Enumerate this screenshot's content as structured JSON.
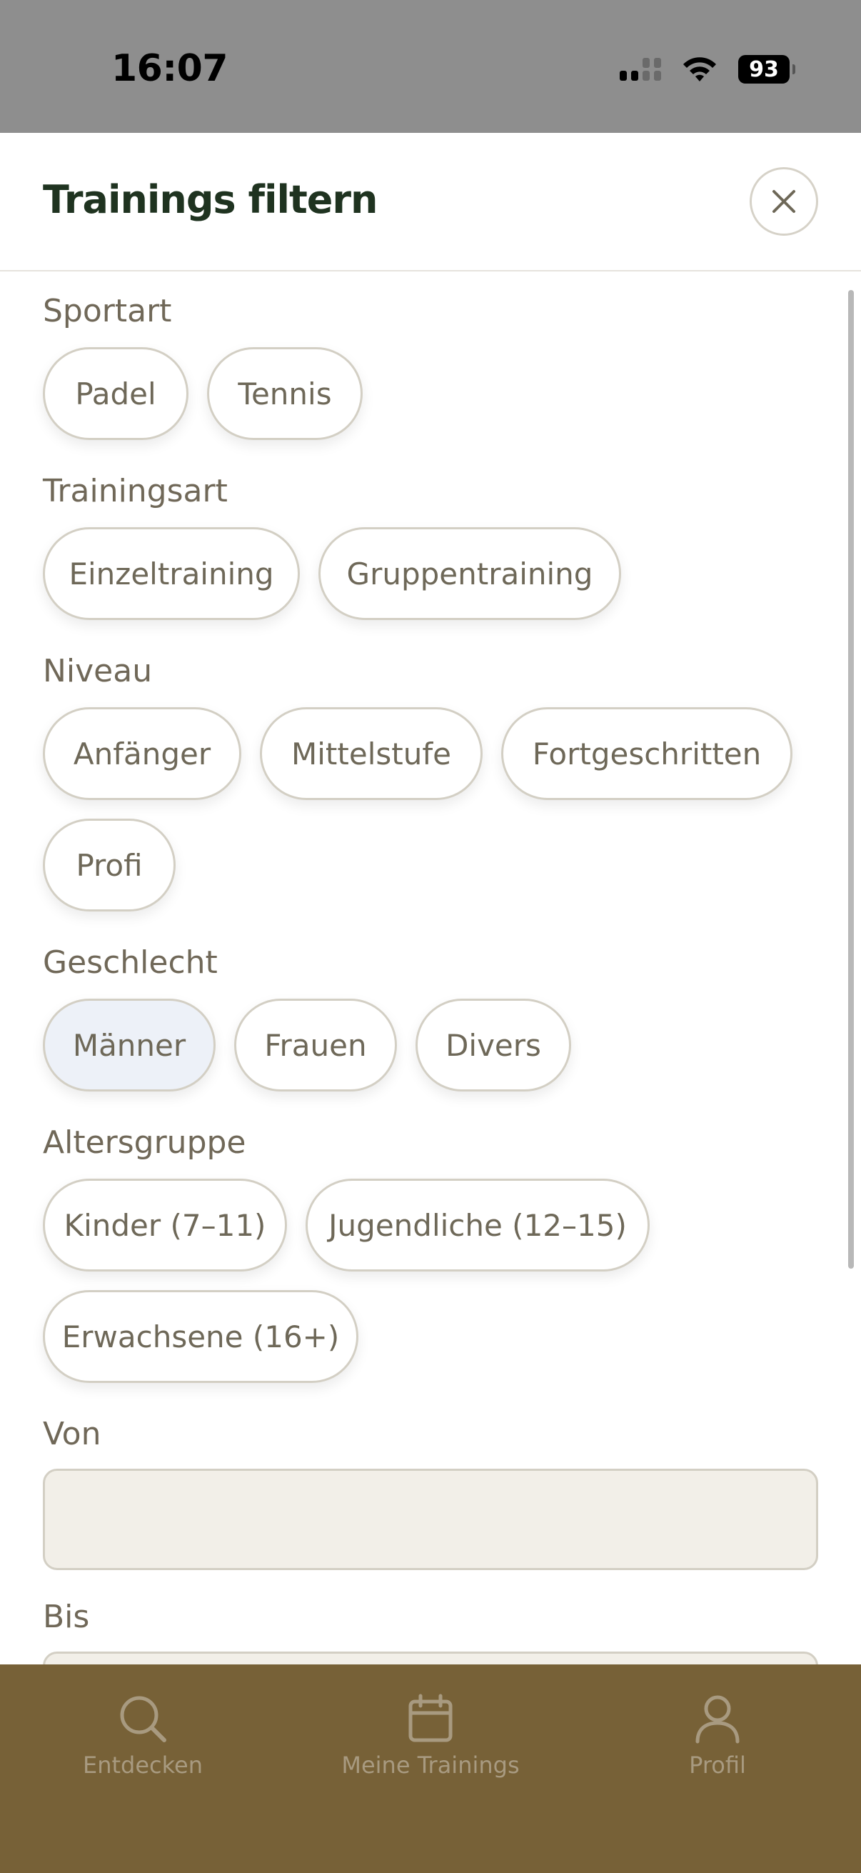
{
  "status": {
    "time": "16:07",
    "battery": "93"
  },
  "sheet": {
    "title": "Trainings filtern"
  },
  "sections": {
    "sport": {
      "label": "Sportart",
      "chips": [
        "Padel",
        "Tennis"
      ]
    },
    "type": {
      "label": "Trainingsart",
      "chips": [
        "Einzeltraining",
        "Gruppentraining"
      ]
    },
    "level": {
      "label": "Niveau",
      "chips": [
        "Anfänger",
        "Mittelstufe",
        "Fortgeschritten",
        "Profi"
      ]
    },
    "gender": {
      "label": "Geschlecht",
      "chips": [
        "Männer",
        "Frauen",
        "Divers"
      ],
      "selected": "Männer"
    },
    "age": {
      "label": "Altersgruppe",
      "chips": [
        "Kinder (7–11)",
        "Jugendliche (12–15)",
        "Erwachsene (16+)"
      ]
    },
    "from": {
      "label": "Von",
      "value": ""
    },
    "to": {
      "label": "Bis",
      "value": ""
    }
  },
  "tabs": [
    {
      "label": "Entdecken",
      "icon": "search-icon"
    },
    {
      "label": "Meine Trainings",
      "icon": "calendar-icon"
    },
    {
      "label": "Profil",
      "icon": "person-icon"
    }
  ]
}
